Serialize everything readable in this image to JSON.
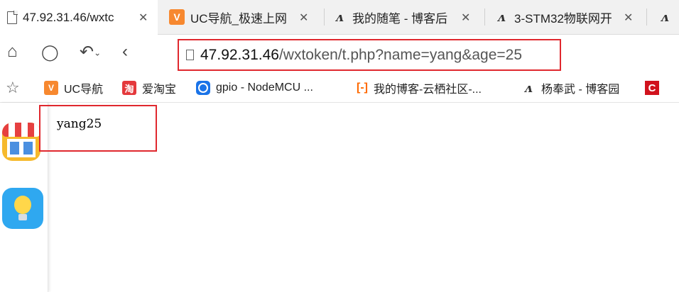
{
  "tabs": [
    {
      "title": "47.92.31.46/wxtc",
      "icon": "document-icon",
      "active": true
    },
    {
      "title": "UC导航_极速上网",
      "icon": "uc-icon",
      "active": false
    },
    {
      "title": "我的随笔 - 博客后",
      "icon": "cnblogs-icon",
      "active": false
    },
    {
      "title": "3-STM32物联网开",
      "icon": "cnblogs-icon",
      "active": false
    }
  ],
  "toolbar": {
    "url_host": "47.92.31.46",
    "url_path": "/wxtoken/t.php?name=yang&age=25"
  },
  "bookmarks": [
    {
      "label": "UC导航",
      "icon": "uc-icon",
      "glyph": "V"
    },
    {
      "label": "爱淘宝",
      "icon": "taobao-icon",
      "glyph": "淘"
    },
    {
      "label": "gpio - NodeMCU ...",
      "icon": "gpio-icon"
    },
    {
      "label": "我的博客-云栖社区-...",
      "icon": "aliyun-icon",
      "glyph": "[-]"
    },
    {
      "label": "杨奉武 - 博客园",
      "icon": "cnblogs-icon"
    },
    {
      "label": "",
      "icon": "c-icon",
      "glyph": "C"
    }
  ],
  "page": {
    "output_text": "yang25"
  },
  "colors": {
    "highlight": "#e0282e",
    "uc_orange": "#f7882f",
    "tab_strip": "#f1f1f1"
  }
}
